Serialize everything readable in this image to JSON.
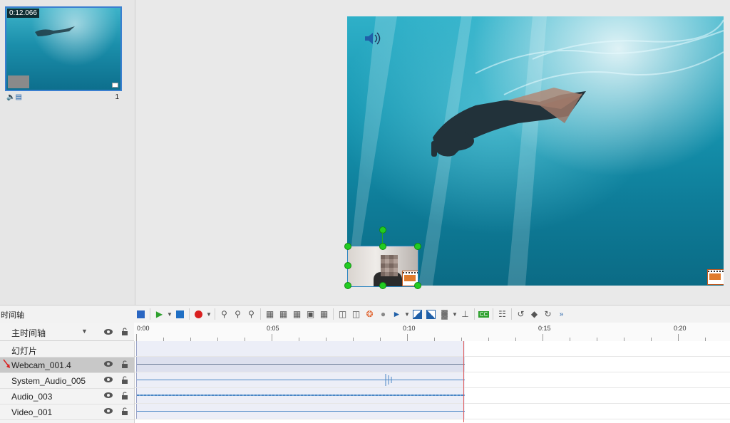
{
  "slide_panel": {
    "thumbnail_duration": "0:12.066",
    "slide_number": "1"
  },
  "timeline": {
    "title": "时间轴",
    "main_track_label": "主时间轴",
    "ruler_labels": [
      "0:00",
      "0:05",
      "0:10",
      "0:15",
      "0:20"
    ],
    "tracks": [
      {
        "label": "幻灯片",
        "selected": false
      },
      {
        "label": "Webcam_001.4",
        "selected": true
      },
      {
        "label": "System_Audio_005",
        "selected": false
      },
      {
        "label": "Audio_003",
        "selected": false
      },
      {
        "label": "Video_001",
        "selected": false
      }
    ],
    "clip_end_time": "0:12.066",
    "toolbar_icons": [
      "stop-square-icon",
      "play-icon",
      "play-dropdown-icon",
      "stop-icon",
      "record-icon",
      "record-dropdown-icon",
      "zoom-fit-icon",
      "zoom-out-icon",
      "zoom-in-icon",
      "align-left-icon",
      "align-top-icon",
      "align-right-icon",
      "crop-icon",
      "align-bottom-icon",
      "split-icon",
      "join-icon",
      "runner-icon",
      "drop-icon",
      "volume-icon",
      "volume-dropdown-icon",
      "fade-in-icon",
      "fade-out-icon",
      "chart-icon",
      "chart-dropdown-icon",
      "marker-icon",
      "cc-icon",
      "chapter-icon",
      "undo-icon",
      "diamond-icon",
      "redo-icon",
      "more-icon"
    ]
  },
  "colors": {
    "selection_blue": "#3a7fd0",
    "handle_green": "#22cc22",
    "playhead_red": "#e05a5a",
    "record_red": "#d92020",
    "play_green": "#2da02d"
  }
}
